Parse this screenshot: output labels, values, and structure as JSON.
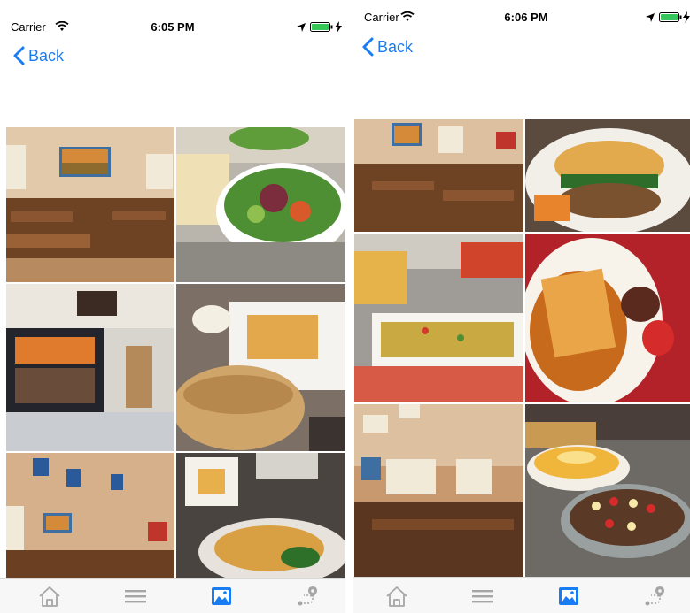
{
  "left_screen": {
    "status": {
      "carrier": "Carrier",
      "time": "6:05 PM"
    },
    "nav": {
      "back_label": "Back"
    },
    "gallery": {
      "tiles": [
        "restaurant-interior-photo",
        "salad-bowl-photo",
        "storefront-photo",
        "sandwich-fries-photo",
        "dining-hall-photo",
        "sandwich-closeup-photo"
      ]
    },
    "tabs": [
      {
        "icon": "home-icon"
      },
      {
        "icon": "menu-icon"
      },
      {
        "icon": "gallery-icon",
        "active": true
      },
      {
        "icon": "location-icon"
      }
    ]
  },
  "right_screen": {
    "status": {
      "carrier": "Carrier",
      "time": "6:06 PM"
    },
    "nav": {
      "back_label": "Back"
    },
    "gallery": {
      "tiles": [
        "restaurant-interior-photo",
        "burger-photo",
        "buffet-photo",
        "dessert-photo",
        "dining-hall-photo",
        "flan-cake-photo"
      ]
    },
    "tabs": [
      {
        "icon": "home-icon"
      },
      {
        "icon": "menu-icon"
      },
      {
        "icon": "gallery-icon",
        "active": true
      },
      {
        "icon": "location-icon"
      }
    ]
  },
  "colors": {
    "accent": "#1a7cf2",
    "tab_inactive": "#a6a6a6",
    "battery": "#35c759"
  }
}
